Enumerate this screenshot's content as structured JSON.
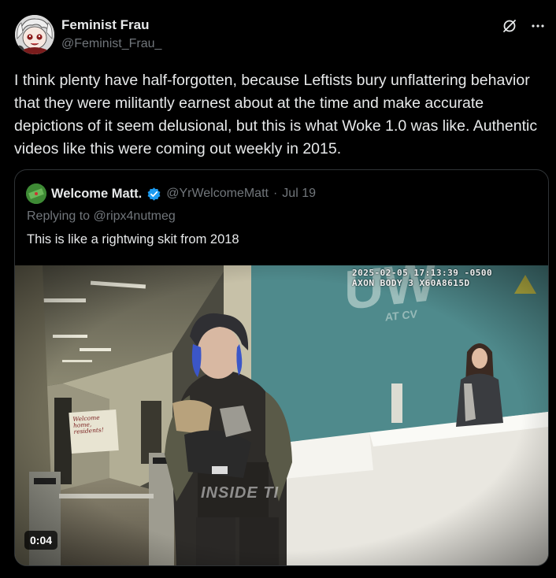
{
  "post": {
    "author": {
      "display_name": "Feminist Frau",
      "handle": "@Feminist_Frau_",
      "avatar": "anime-avatar"
    },
    "icons": [
      "grok-icon",
      "more-icon"
    ],
    "text": "I think plenty have half-forgotten, because Leftists bury unflattering behavior that they were militantly earnest about at the time and make accurate depictions of it seem delusional, but this is what Woke 1.0 was like. Authentic videos like this were coming out weekly in 2015."
  },
  "quote": {
    "display_name": "Welcome Matt.",
    "verified": true,
    "handle": "@YrWelcomeMatt",
    "separator": "·",
    "date": "Jul 19",
    "replying_prefix": "Replying to ",
    "replying_to": "@ripx4nutmeg",
    "text": "This is like a rightwing skit from 2018",
    "video": {
      "overlay_line1": "2025-02-05 17:13:39 -0500",
      "overlay_line2": "AXON BODY 3 X60A8615D",
      "wall_logo": "UW",
      "wall_logo_sub": "AT CV",
      "sign_text": "Welcome home, residents!",
      "shirt_text": "INSIDE TI",
      "duration": "0:04"
    }
  },
  "colors": {
    "background": "#000000",
    "text_primary": "#e7e9ea",
    "text_secondary": "#71767b",
    "border": "#2f3336",
    "verified": "#1d9bf0",
    "wall_teal": "#4f8a8c"
  }
}
